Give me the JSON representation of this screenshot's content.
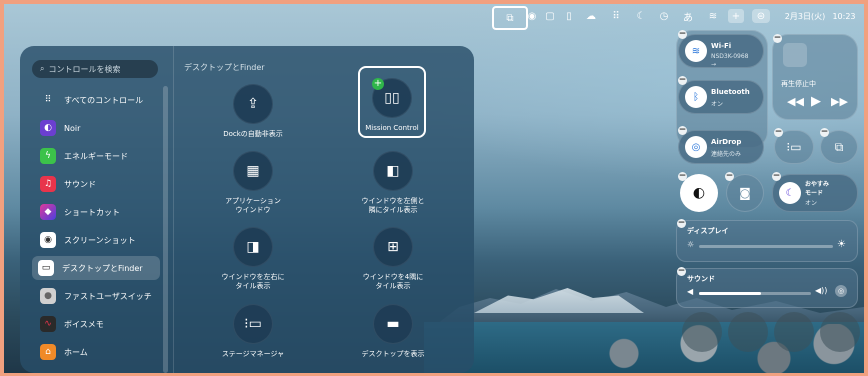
{
  "menubar": {
    "icons": [
      {
        "name": "mission-control-icon",
        "glyph": "⧉"
      },
      {
        "name": "screenshot-icon",
        "glyph": "◉"
      },
      {
        "name": "stage-manager-icon",
        "glyph": "▢"
      },
      {
        "name": "battery-icon",
        "glyph": "▯"
      },
      {
        "name": "icloud-icon",
        "glyph": "☁"
      },
      {
        "name": "grid-icon",
        "glyph": "⠿"
      },
      {
        "name": "moon-icon",
        "glyph": "☾"
      },
      {
        "name": "clock-icon",
        "glyph": "◷"
      },
      {
        "name": "input-method-icon",
        "glyph": "あ"
      },
      {
        "name": "wifi-icon",
        "glyph": "≋"
      },
      {
        "name": "plus-icon",
        "glyph": "+"
      },
      {
        "name": "control-center-icon",
        "glyph": "⊜"
      }
    ],
    "date": "2月3日(火)",
    "time": "10:23"
  },
  "panel": {
    "search_placeholder": "コントロールを検索",
    "section_title": "デスクトップとFinder",
    "sidebar": [
      {
        "label": "すべてのコントロール",
        "color": "transparent",
        "glyph": "⠿"
      },
      {
        "label": "Noir",
        "color": "#6b3fd0",
        "glyph": "◐"
      },
      {
        "label": "エネルギーモード",
        "color": "#3cc24a",
        "glyph": "ϟ"
      },
      {
        "label": "サウンド",
        "color": "#e8344b",
        "glyph": "♫"
      },
      {
        "label": "ショートカット",
        "color": "#7a3fe0",
        "glyph": "◆"
      },
      {
        "label": "スクリーンショット",
        "color": "#ffffff",
        "glyph": "◉"
      },
      {
        "label": "デスクトップとFinder",
        "color": "#ffffff",
        "glyph": "▭"
      },
      {
        "label": "ファストユーザスイッチ",
        "color": "#d0d0d0",
        "glyph": "●"
      },
      {
        "label": "ボイスメモ",
        "color": "#2a2a2a",
        "glyph": "∿"
      },
      {
        "label": "ホーム",
        "color": "#f08a28",
        "glyph": "⌂"
      }
    ],
    "tiles": [
      {
        "label": "Dockの自動非表示",
        "glyph": "⇪"
      },
      {
        "label": "Mission Control",
        "glyph": "▯▯"
      },
      {
        "label": "アプリケーション\nウインドウ",
        "glyph": "▦"
      },
      {
        "label": "ウインドウを左側と\n隣にタイル表示",
        "glyph": "◧"
      },
      {
        "label": "ウインドウを左右に\nタイル表示",
        "glyph": "◨"
      },
      {
        "label": "ウインドウを4隅に\nタイル表示",
        "glyph": "⊞"
      },
      {
        "label": "ステージマネージャ",
        "glyph": "⁝▭"
      },
      {
        "label": "デスクトップを表示",
        "glyph": "▬"
      }
    ]
  },
  "control_center": {
    "wifi": {
      "title": "Wi-Fi",
      "sub": "NSD3K-0968",
      "sub2": "→"
    },
    "bluetooth": {
      "title": "Bluetooth",
      "sub": "オン"
    },
    "airdrop": {
      "title": "AirDrop",
      "sub": "連絡先のみ"
    },
    "now_playing": {
      "title": "再生停止中"
    },
    "focus": {
      "title": "おやすみ",
      "line2": "モード",
      "sub": "オン"
    },
    "display": {
      "title": "ディスプレイ",
      "level": 0
    },
    "sound": {
      "title": "サウンド",
      "level": 0.55
    }
  }
}
